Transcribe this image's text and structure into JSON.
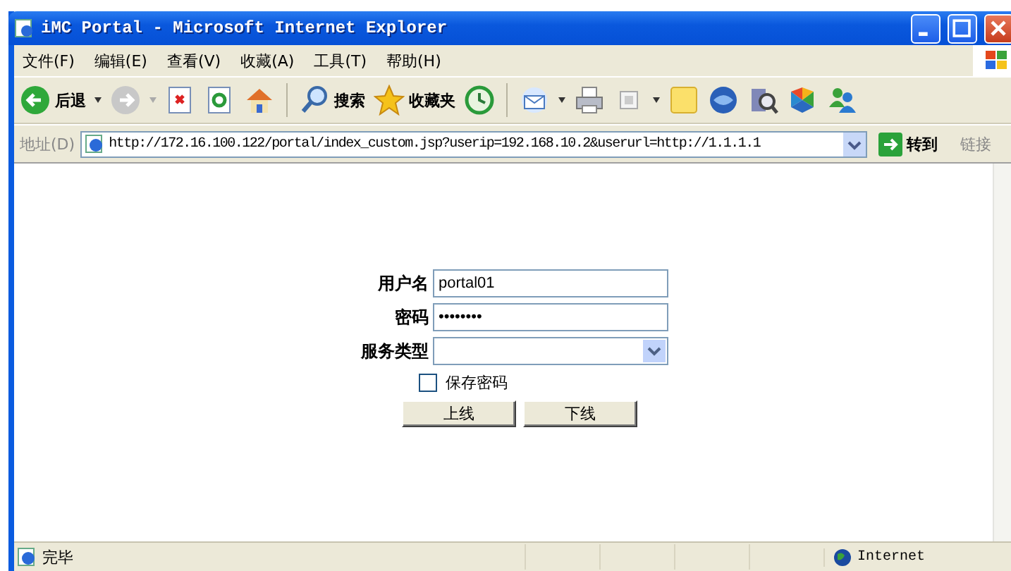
{
  "window": {
    "title": "iMC Portal - Microsoft Internet Explorer"
  },
  "menu": [
    "文件(F)",
    "编辑(E)",
    "查看(V)",
    "收藏(A)",
    "工具(T)",
    "帮助(H)"
  ],
  "toolbar": {
    "back": "后退",
    "search": "搜索",
    "favorites": "收藏夹"
  },
  "address_bar": {
    "label": "地址(D)",
    "url": "http://172.16.100.122/portal/index_custom.jsp?userip=192.168.10.2&userurl=http://1.1.1.1",
    "go": "转到",
    "links": "链接"
  },
  "login_form": {
    "fields": [
      {
        "label": "用户名",
        "kind": "text",
        "value": "portal01"
      },
      {
        "label": "密码",
        "kind": "text",
        "value": "••••••••"
      },
      {
        "label": "服务类型",
        "kind": "select"
      }
    ],
    "remember": {
      "label": "保存密码",
      "checked": false
    },
    "buttons": [
      "上线",
      "下线"
    ]
  },
  "status_bar": {
    "text": "完毕",
    "zone": "Internet"
  }
}
